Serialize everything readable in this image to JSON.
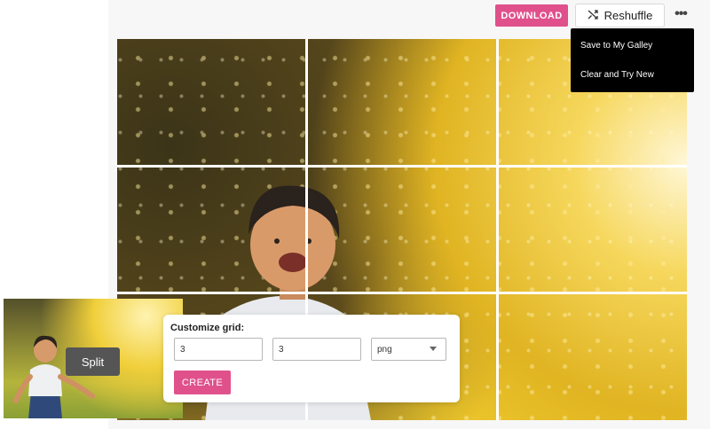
{
  "toolbar": {
    "download_label": "DOWNLOAD",
    "reshuffle_label": "Reshuffle",
    "reshuffle_icon": "shuffle-icon",
    "more_icon": "more-horizontal-icon",
    "more_glyph": "•••"
  },
  "menu": {
    "items": [
      {
        "label": "Save to My Galley"
      },
      {
        "label": "Clear and Try New"
      }
    ]
  },
  "thumbnail": {
    "split_label": "Split"
  },
  "customize": {
    "title": "Customize grid:",
    "rows_value": "3",
    "cols_value": "3",
    "format_value": "png",
    "create_label": "CREATE"
  },
  "colors": {
    "accent": "#e0518c",
    "menu_bg": "#000000",
    "gridline": "#ffffff"
  }
}
